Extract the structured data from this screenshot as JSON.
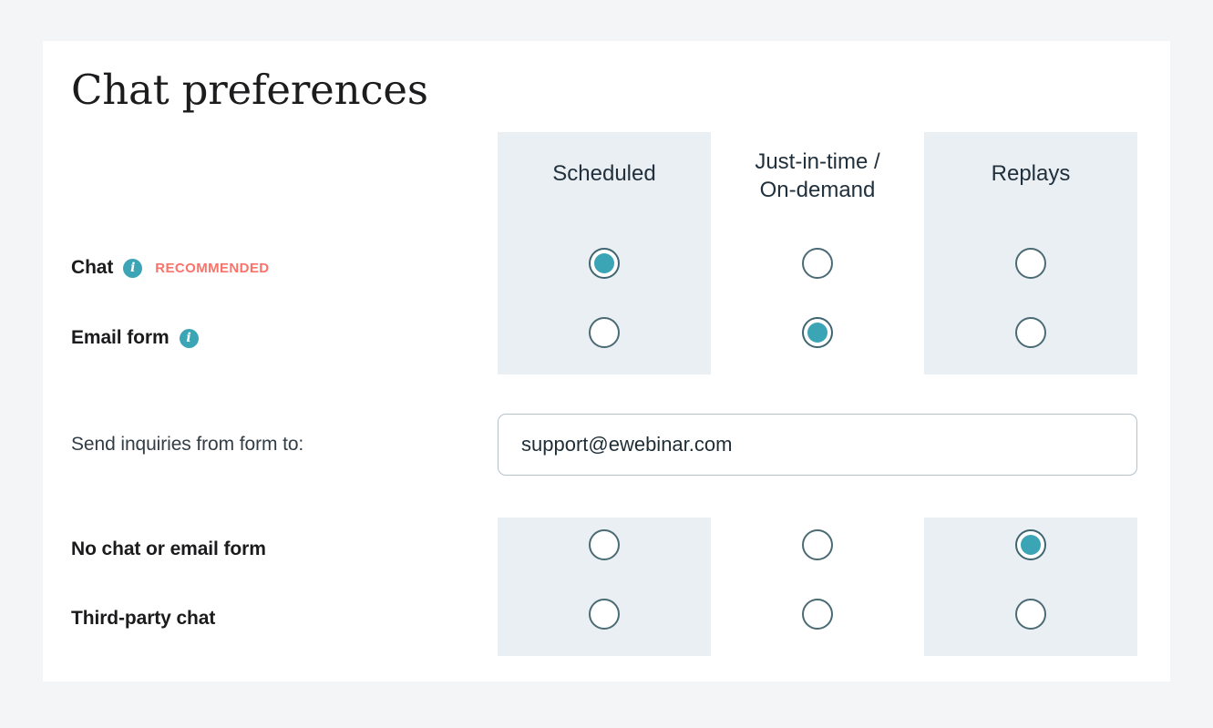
{
  "page": {
    "background_color": "#f4f5f7",
    "card_background": "#ffffff",
    "title": "Chat preferences"
  },
  "colors": {
    "accent_teal": "#3ba5b5",
    "recommended_coral": "#fa7268",
    "column_band": "#eaeff3",
    "radio_ring": "#4b6b74",
    "input_border": "#b4c3cb"
  },
  "columns": [
    {
      "id": "scheduled",
      "label": "Scheduled",
      "shaded": true
    },
    {
      "id": "just-in-time",
      "label": "Just-in-time /\nOn-demand",
      "label_line1": "Just-in-time /",
      "label_line2": "On-demand",
      "shaded": false
    },
    {
      "id": "replays",
      "label": "Replays",
      "shaded": true
    }
  ],
  "rows": {
    "chat": {
      "label": "Chat",
      "bold": true,
      "info_icon": "info-icon",
      "badge": "RECOMMENDED",
      "selection": "scheduled",
      "radios": [
        {
          "column": "scheduled",
          "selected": true
        },
        {
          "column": "just-in-time",
          "selected": false
        },
        {
          "column": "replays",
          "selected": false
        }
      ]
    },
    "email_form": {
      "label": "Email form",
      "bold": true,
      "info_icon": "info-icon",
      "selection": "just-in-time",
      "radios": [
        {
          "column": "scheduled",
          "selected": false
        },
        {
          "column": "just-in-time",
          "selected": true
        },
        {
          "column": "replays",
          "selected": false
        }
      ]
    },
    "no_chat": {
      "label": "No chat or email form",
      "bold": true,
      "selection": "replays",
      "radios": [
        {
          "column": "scheduled",
          "selected": false
        },
        {
          "column": "just-in-time",
          "selected": false
        },
        {
          "column": "replays",
          "selected": true
        }
      ]
    },
    "third_party": {
      "label": "Third-party chat",
      "bold": true,
      "selection": null,
      "radios": [
        {
          "column": "scheduled",
          "selected": false
        },
        {
          "column": "just-in-time",
          "selected": false
        },
        {
          "column": "replays",
          "selected": false
        }
      ]
    }
  },
  "inquiries": {
    "label": "Send inquiries from form to:",
    "value": "support@ewebinar.com",
    "placeholder": "support@ewebinar.com"
  }
}
